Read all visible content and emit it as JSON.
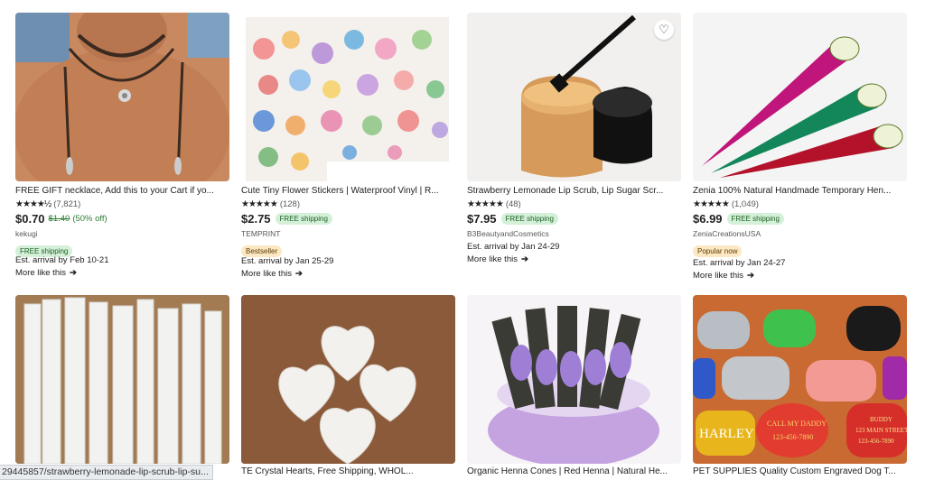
{
  "products": [
    {
      "title": "FREE GIFT necklace, Add this to your Cart if yo...",
      "stars": "★★★★½",
      "reviews": "(7,821)",
      "price": "$0.70",
      "original_price": "$1.40",
      "discount": "(50% off)",
      "shop": "kekugi",
      "free_shipping": "FREE shipping",
      "arrival": "Est. arrival by Feb 10-21",
      "more": "More like this",
      "arrow": "➔"
    },
    {
      "title": "Cute Tiny Flower Stickers | Waterproof Vinyl | R...",
      "stars": "★★★★★",
      "reviews": "(128)",
      "price": "$2.75",
      "free_shipping": "FREE shipping",
      "shop": "TEMPRINT",
      "badge": "Bestseller",
      "arrival": "Est. arrival by Jan 25-29",
      "more": "More like this",
      "arrow": "➔"
    },
    {
      "title": "Strawberry Lemonade Lip Scrub, Lip Sugar Scr...",
      "stars": "★★★★★",
      "reviews": "(48)",
      "price": "$7.95",
      "free_shipping": "FREE shipping",
      "shop": "B3BeautyandCosmetics",
      "arrival": "Est. arrival by Jan 24-29",
      "more": "More like this",
      "arrow": "➔",
      "favorite_icon": "♡"
    },
    {
      "title": "Zenia 100% Natural Handmade Temporary Hen...",
      "stars": "★★★★★",
      "reviews": "(1,049)",
      "price": "$6.99",
      "free_shipping": "FREE shipping",
      "shop": "ZeniaCreationsUSA",
      "badge": "Popular now",
      "arrival": "Est. arrival by Jan 24-27",
      "more": "More like this",
      "arrow": "➔"
    }
  ],
  "bottom_titles": [
    "",
    "TE Crystal Hearts, Free Shipping, WHOL...",
    "Organic Henna Cones | Red Henna | Natural He...",
    "PET SUPPLIES Quality Custom Engraved Dog T..."
  ],
  "tag_texts": [
    "HARLEY",
    "CALL MY DADDY",
    "123-456-7890",
    "BUDDY",
    "123 MAIN STREET",
    "123-456-7890"
  ],
  "status_url": "29445857/strawberry-lemonade-lip-scrub-lip-su..."
}
